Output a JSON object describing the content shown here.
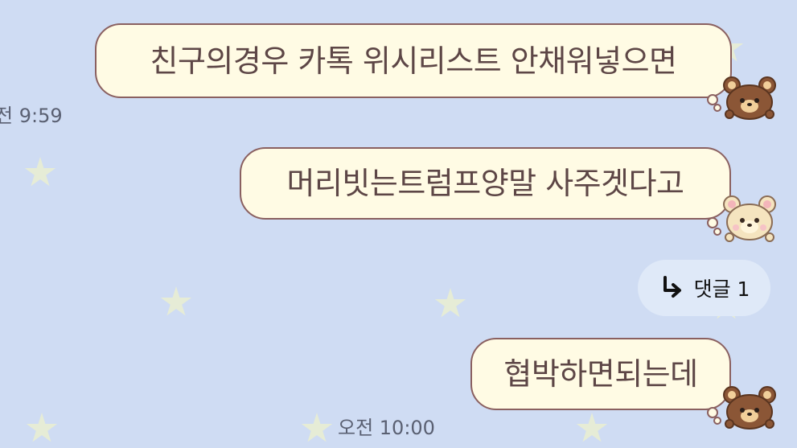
{
  "messages": [
    {
      "text": "친구의경우 카톡 위시리스트 안채워넣으면",
      "avatar": "brown-bear-icon"
    },
    {
      "text": "머리빗는트럼프양말 사주겟다고",
      "avatar": "cream-bear-icon"
    },
    {
      "text": "협박하면되는데",
      "avatar": "brown-bear-icon"
    }
  ],
  "timestamps": {
    "first": "전 9:59",
    "last": "오전 10:00"
  },
  "reply": {
    "icon": "reply-arrow-icon",
    "label": "댓글 1"
  },
  "colors": {
    "background": "#cfdcf3",
    "bubble_fill": "#fffbe4",
    "bubble_border": "#8a6060",
    "bubble_text": "#5d4646",
    "timestamp": "#5a6072",
    "star": "#e6ecd6",
    "reply_pill": "#dfe9f8"
  }
}
